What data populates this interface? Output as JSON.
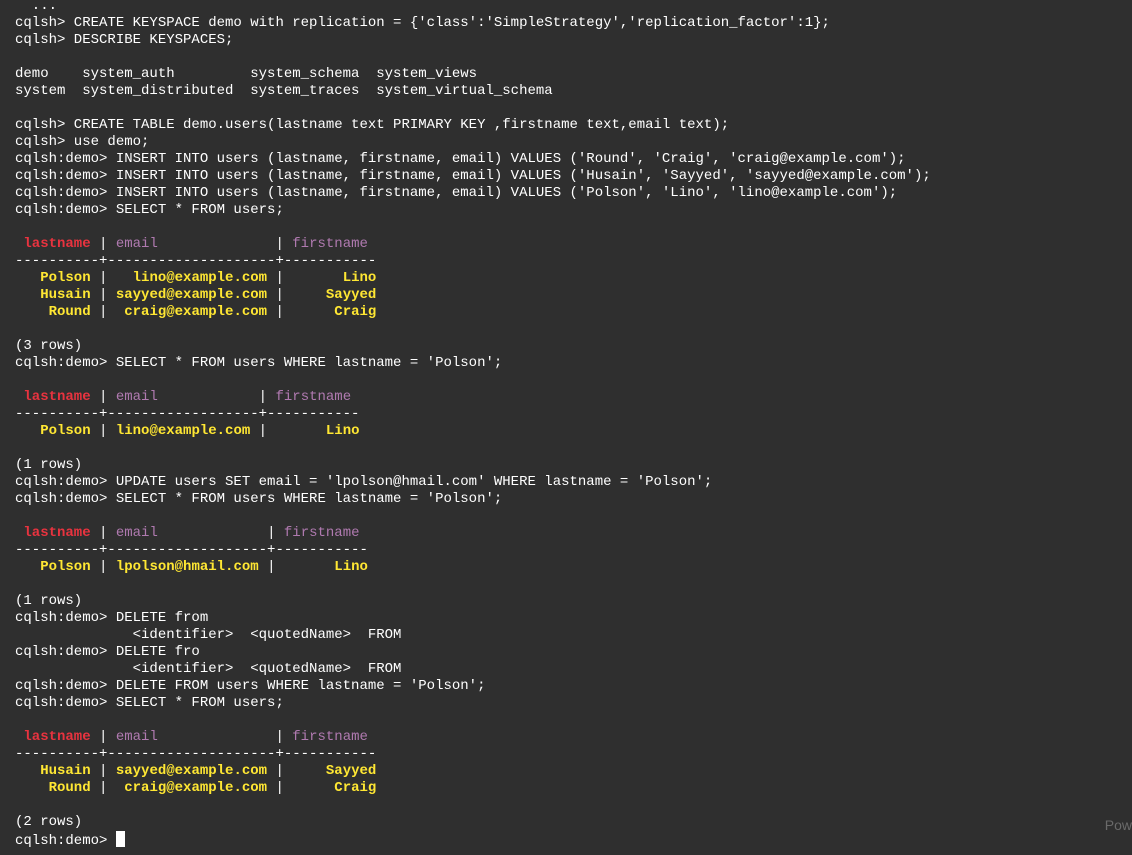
{
  "terminal": {
    "lines": [
      [
        {
          "t": "  ...",
          "c": "white"
        }
      ],
      [
        {
          "t": "cqlsh> CREATE KEYSPACE demo with replication = {'class':'SimpleStrategy','replication_factor':1};",
          "c": "white"
        }
      ],
      [
        {
          "t": "cqlsh> DESCRIBE KEYSPACES;",
          "c": "white"
        }
      ],
      [],
      [
        {
          "t": "demo    system_auth         system_schema  system_views",
          "c": "white"
        }
      ],
      [
        {
          "t": "system  system_distributed  system_traces  system_virtual_schema",
          "c": "white"
        }
      ],
      [],
      [
        {
          "t": "cqlsh> CREATE TABLE demo.users(lastname text PRIMARY KEY ,firstname text,email text);",
          "c": "white"
        }
      ],
      [
        {
          "t": "cqlsh> use demo;",
          "c": "white"
        }
      ],
      [
        {
          "t": "cqlsh:demo> INSERT INTO users (lastname, firstname, email) VALUES ('Round', 'Craig', 'craig@example.com');",
          "c": "white"
        }
      ],
      [
        {
          "t": "cqlsh:demo> INSERT INTO users (lastname, firstname, email) VALUES ('Husain', 'Sayyed', 'sayyed@example.com');",
          "c": "white"
        }
      ],
      [
        {
          "t": "cqlsh:demo> INSERT INTO users (lastname, firstname, email) VALUES ('Polson', 'Lino', 'lino@example.com');",
          "c": "white"
        }
      ],
      [
        {
          "t": "cqlsh:demo> SELECT * FROM users;",
          "c": "white"
        }
      ],
      [],
      [
        {
          "t": " lastname",
          "c": "red"
        },
        {
          "t": " | ",
          "c": "white"
        },
        {
          "t": "email",
          "c": "mag"
        },
        {
          "t": "              | ",
          "c": "white"
        },
        {
          "t": "firstname",
          "c": "mag"
        }
      ],
      [
        {
          "t": "----------+--------------------+-----------",
          "c": "white"
        }
      ],
      [
        {
          "t": "   Polson",
          "c": "yellow"
        },
        {
          "t": " | ",
          "c": "white"
        },
        {
          "t": "  lino@example.com",
          "c": "yellow"
        },
        {
          "t": " | ",
          "c": "white"
        },
        {
          "t": "      Lino",
          "c": "yellow"
        }
      ],
      [
        {
          "t": "   Husain",
          "c": "yellow"
        },
        {
          "t": " | ",
          "c": "white"
        },
        {
          "t": "sayyed@example.com",
          "c": "yellow"
        },
        {
          "t": " | ",
          "c": "white"
        },
        {
          "t": "    Sayyed",
          "c": "yellow"
        }
      ],
      [
        {
          "t": "    Round",
          "c": "yellow"
        },
        {
          "t": " | ",
          "c": "white"
        },
        {
          "t": " craig@example.com",
          "c": "yellow"
        },
        {
          "t": " | ",
          "c": "white"
        },
        {
          "t": "     Craig",
          "c": "yellow"
        }
      ],
      [],
      [
        {
          "t": "(3 rows)",
          "c": "white"
        }
      ],
      [
        {
          "t": "cqlsh:demo> SELECT * FROM users WHERE lastname = 'Polson';",
          "c": "white"
        }
      ],
      [],
      [
        {
          "t": " lastname",
          "c": "red"
        },
        {
          "t": " | ",
          "c": "white"
        },
        {
          "t": "email",
          "c": "mag"
        },
        {
          "t": "            | ",
          "c": "white"
        },
        {
          "t": "firstname",
          "c": "mag"
        }
      ],
      [
        {
          "t": "----------+------------------+-----------",
          "c": "white"
        }
      ],
      [
        {
          "t": "   Polson",
          "c": "yellow"
        },
        {
          "t": " | ",
          "c": "white"
        },
        {
          "t": "lino@example.com",
          "c": "yellow"
        },
        {
          "t": " | ",
          "c": "white"
        },
        {
          "t": "      Lino",
          "c": "yellow"
        }
      ],
      [],
      [
        {
          "t": "(1 rows)",
          "c": "white"
        }
      ],
      [
        {
          "t": "cqlsh:demo> UPDATE users SET email = 'lpolson@hmail.com' WHERE lastname = 'Polson';",
          "c": "white"
        }
      ],
      [
        {
          "t": "cqlsh:demo> SELECT * FROM users WHERE lastname = 'Polson';",
          "c": "white"
        }
      ],
      [],
      [
        {
          "t": " lastname",
          "c": "red"
        },
        {
          "t": " | ",
          "c": "white"
        },
        {
          "t": "email",
          "c": "mag"
        },
        {
          "t": "             | ",
          "c": "white"
        },
        {
          "t": "firstname",
          "c": "mag"
        }
      ],
      [
        {
          "t": "----------+-------------------+-----------",
          "c": "white"
        }
      ],
      [
        {
          "t": "   Polson",
          "c": "yellow"
        },
        {
          "t": " | ",
          "c": "white"
        },
        {
          "t": "lpolson@hmail.com",
          "c": "yellow"
        },
        {
          "t": " | ",
          "c": "white"
        },
        {
          "t": "      Lino",
          "c": "yellow"
        }
      ],
      [],
      [
        {
          "t": "(1 rows)",
          "c": "white"
        }
      ],
      [
        {
          "t": "cqlsh:demo> DELETE from",
          "c": "white"
        }
      ],
      [
        {
          "t": "              <identifier>  <quotedName>  FROM",
          "c": "white"
        }
      ],
      [
        {
          "t": "cqlsh:demo> DELETE fro",
          "c": "white"
        }
      ],
      [
        {
          "t": "              <identifier>  <quotedName>  FROM",
          "c": "white"
        }
      ],
      [
        {
          "t": "cqlsh:demo> DELETE FROM users WHERE lastname = 'Polson';",
          "c": "white"
        }
      ],
      [
        {
          "t": "cqlsh:demo> SELECT * FROM users;",
          "c": "white"
        }
      ],
      [],
      [
        {
          "t": " lastname",
          "c": "red"
        },
        {
          "t": " | ",
          "c": "white"
        },
        {
          "t": "email",
          "c": "mag"
        },
        {
          "t": "              | ",
          "c": "white"
        },
        {
          "t": "firstname",
          "c": "mag"
        }
      ],
      [
        {
          "t": "----------+--------------------+-----------",
          "c": "white"
        }
      ],
      [
        {
          "t": "   Husain",
          "c": "yellow"
        },
        {
          "t": " | ",
          "c": "white"
        },
        {
          "t": "sayyed@example.com",
          "c": "yellow"
        },
        {
          "t": " | ",
          "c": "white"
        },
        {
          "t": "    Sayyed",
          "c": "yellow"
        }
      ],
      [
        {
          "t": "    Round",
          "c": "yellow"
        },
        {
          "t": " | ",
          "c": "white"
        },
        {
          "t": " craig@example.com",
          "c": "yellow"
        },
        {
          "t": " | ",
          "c": "white"
        },
        {
          "t": "     Craig",
          "c": "yellow"
        }
      ],
      [],
      [
        {
          "t": "(2 rows)",
          "c": "white"
        }
      ]
    ],
    "prompt": "cqlsh:demo> ",
    "watermark": "Pow"
  },
  "colors": {
    "background": "#2f2f2f",
    "text": "#ffffff",
    "header_key": "#e8333f",
    "header_col": "#b07ab0",
    "value": "#ffe733",
    "watermark": "#6a6a6a"
  }
}
